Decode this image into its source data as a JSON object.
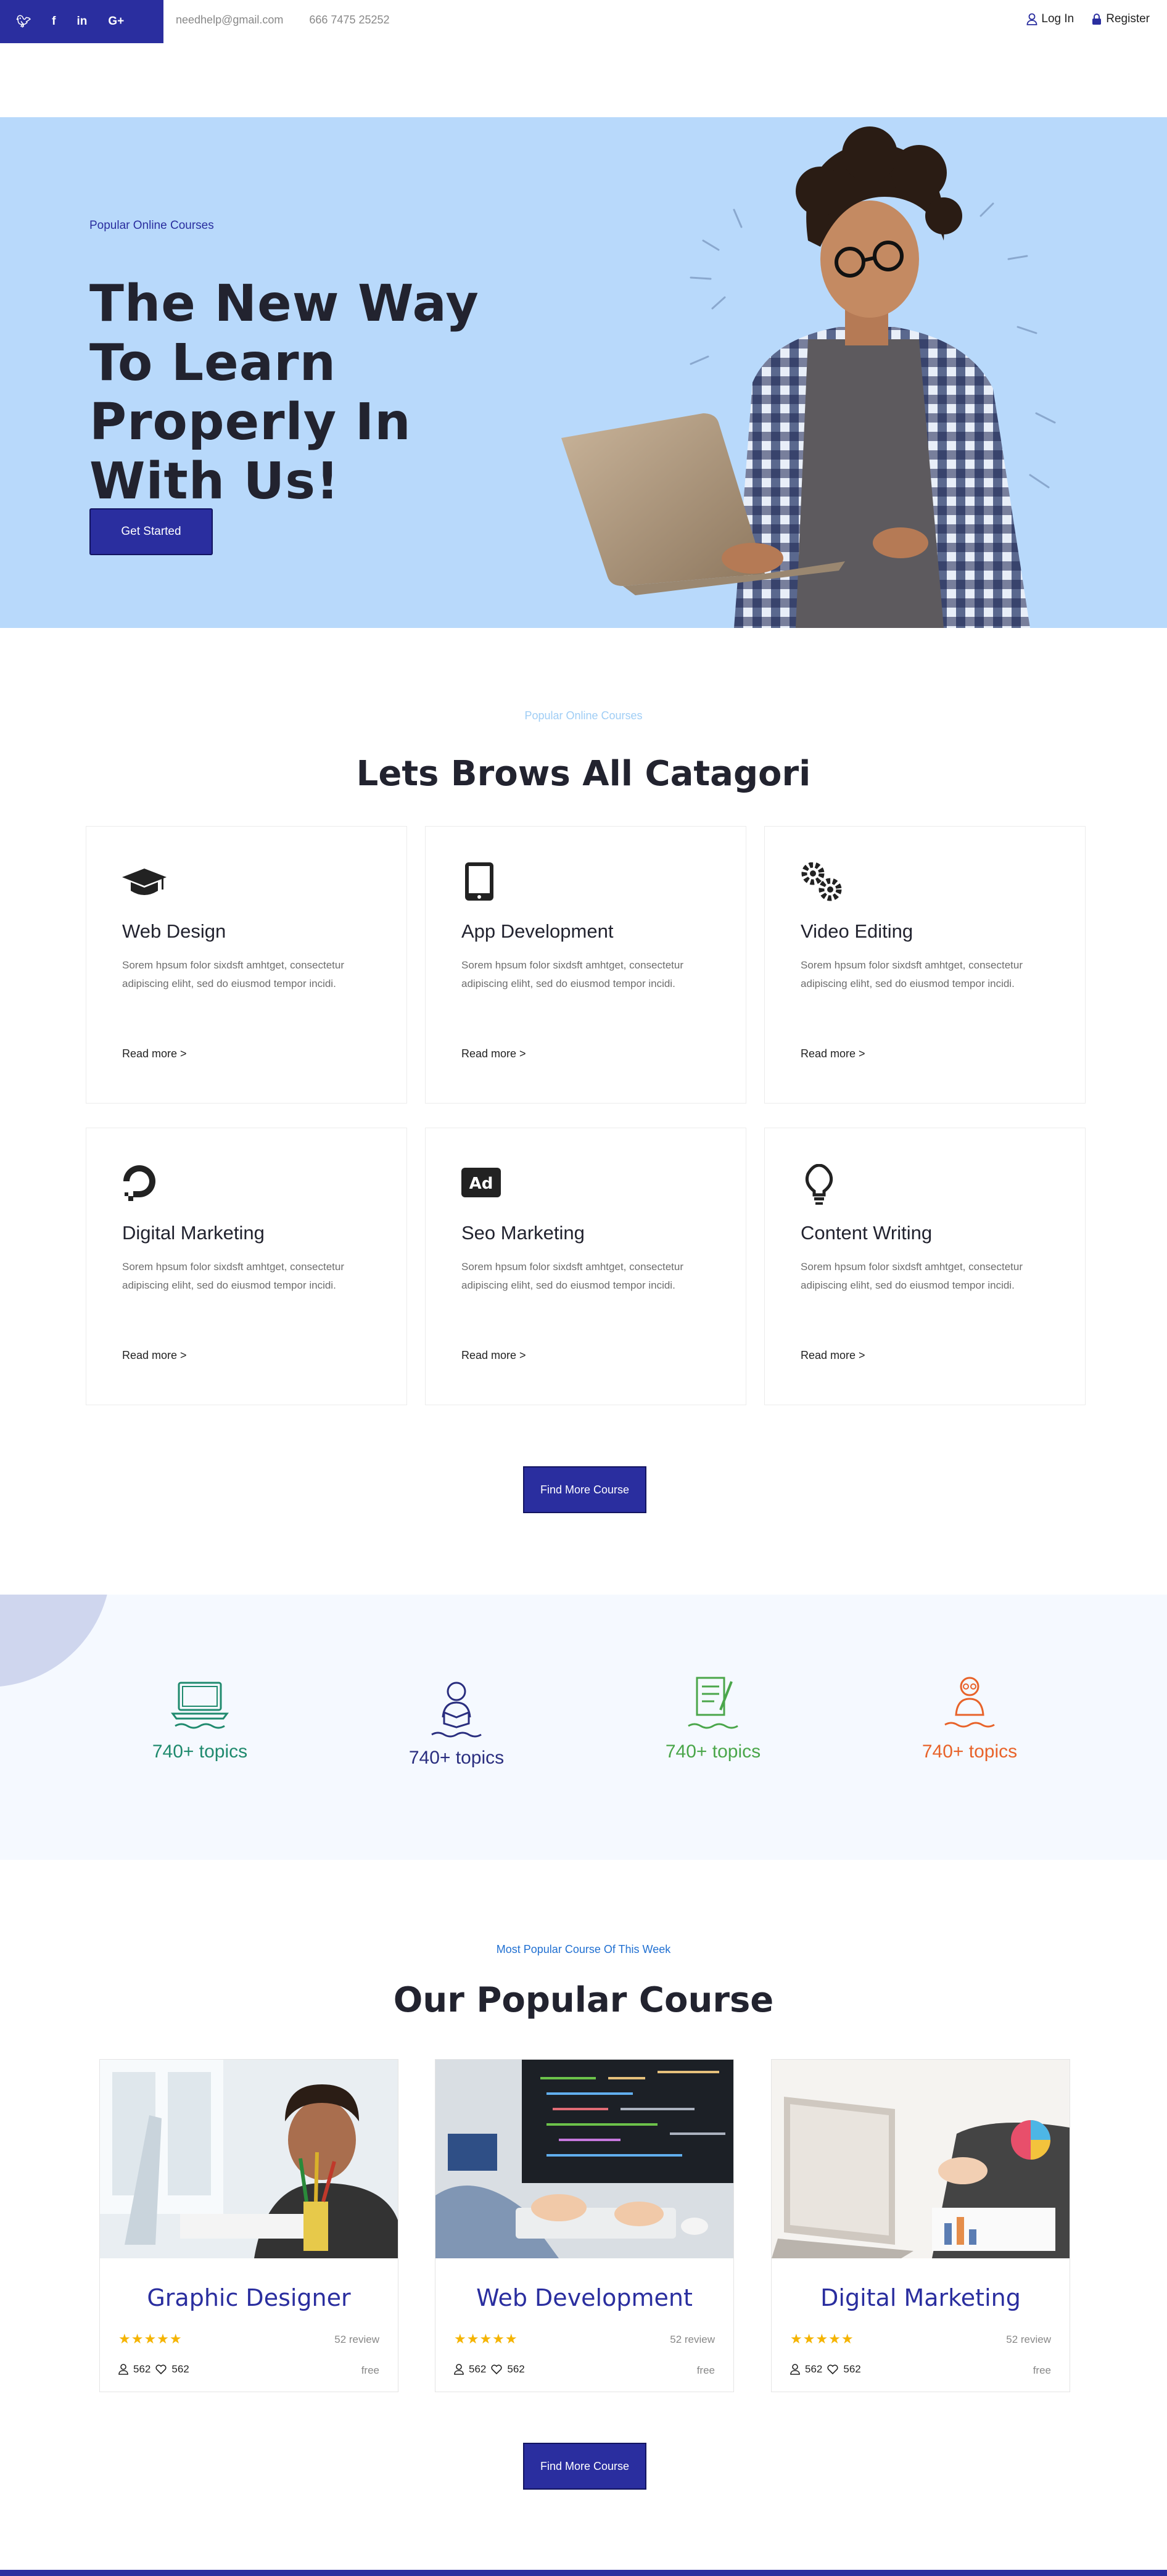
{
  "topbar": {
    "social": [
      "twitter",
      "facebook",
      "in",
      "G+"
    ],
    "email": "needhelp@gmail.com",
    "phone": "666 7475 25252",
    "login": "Log In",
    "register": "Register"
  },
  "hero": {
    "eyebrow": "Popular Online Courses",
    "title": "The New Way To Learn Properly In With Us!",
    "button": "Get Started"
  },
  "categories": {
    "eyebrow": "Popular Online Courses",
    "title": "Lets Brows All Catagori",
    "cards": [
      {
        "icon": "graduation-cap-icon",
        "title": "Web Design",
        "desc": "Sorem hpsum folor sixdsft amhtget, consectetur adipiscing eliht, sed do eiusmod tempor incidi.",
        "link": "Read more >"
      },
      {
        "icon": "tablet-icon",
        "title": "App Development",
        "desc": "Sorem hpsum folor sixdsft amhtget, consectetur adipiscing eliht, sed do eiusmod tempor incidi.",
        "link": "Read more >"
      },
      {
        "icon": "gears-icon",
        "title": "Video Editing",
        "desc": "Sorem hpsum folor sixdsft amhtget, consectetur adipiscing eliht, sed do eiusmod tempor incidi.",
        "link": "Read more >"
      },
      {
        "icon": "digital-ocean-icon",
        "title": "Digital Marketing",
        "desc": "Sorem hpsum folor sixdsft amhtget, consectetur adipiscing eliht, sed do eiusmod tempor incidi.",
        "link": "Read more >"
      },
      {
        "icon": "ad-icon",
        "title": "Seo Marketing",
        "desc": "Sorem hpsum folor sixdsft amhtget, consectetur adipiscing eliht, sed do eiusmod tempor incidi.",
        "link": "Read more >"
      },
      {
        "icon": "lightbulb-icon",
        "title": "Content Writing",
        "desc": "Sorem hpsum folor sixdsft amhtget, consectetur adipiscing eliht, sed do eiusmod tempor incidi.",
        "link": "Read more >"
      }
    ],
    "more_button": "Find More Course"
  },
  "stats": [
    {
      "icon": "laptop-icon",
      "text": "740+ topics",
      "color": "#1f8a6e"
    },
    {
      "icon": "reader-icon",
      "text": "740+ topics",
      "color": "#2a2e7f"
    },
    {
      "icon": "document-pen-icon",
      "text": "740+ topics",
      "color": "#4aa64a"
    },
    {
      "icon": "teacher-icon",
      "text": "740+ topics",
      "color": "#e8632a"
    }
  ],
  "popular": {
    "eyebrow": "Most Popular Course Of This Week",
    "title": "Our Popular Course",
    "courses": [
      {
        "name": "Graphic Designer",
        "stars": "★★★★★",
        "review": "52 review",
        "students": "562",
        "likes": "562",
        "price": "free"
      },
      {
        "name": "Web Development",
        "stars": "★★★★★",
        "review": "52 review",
        "students": "562",
        "likes": "562",
        "price": "free"
      },
      {
        "name": "Digital Marketing",
        "stars": "★★★★★",
        "review": "52 review",
        "students": "562",
        "likes": "562",
        "price": "free"
      }
    ],
    "more_button": "Find More Course"
  },
  "colors": {
    "brand": "#2a2e9f",
    "hero_bg": "#b8d9fb",
    "eyebrow_light": "#9fcdf5",
    "eyebrow_blue": "#1f6fd1"
  }
}
